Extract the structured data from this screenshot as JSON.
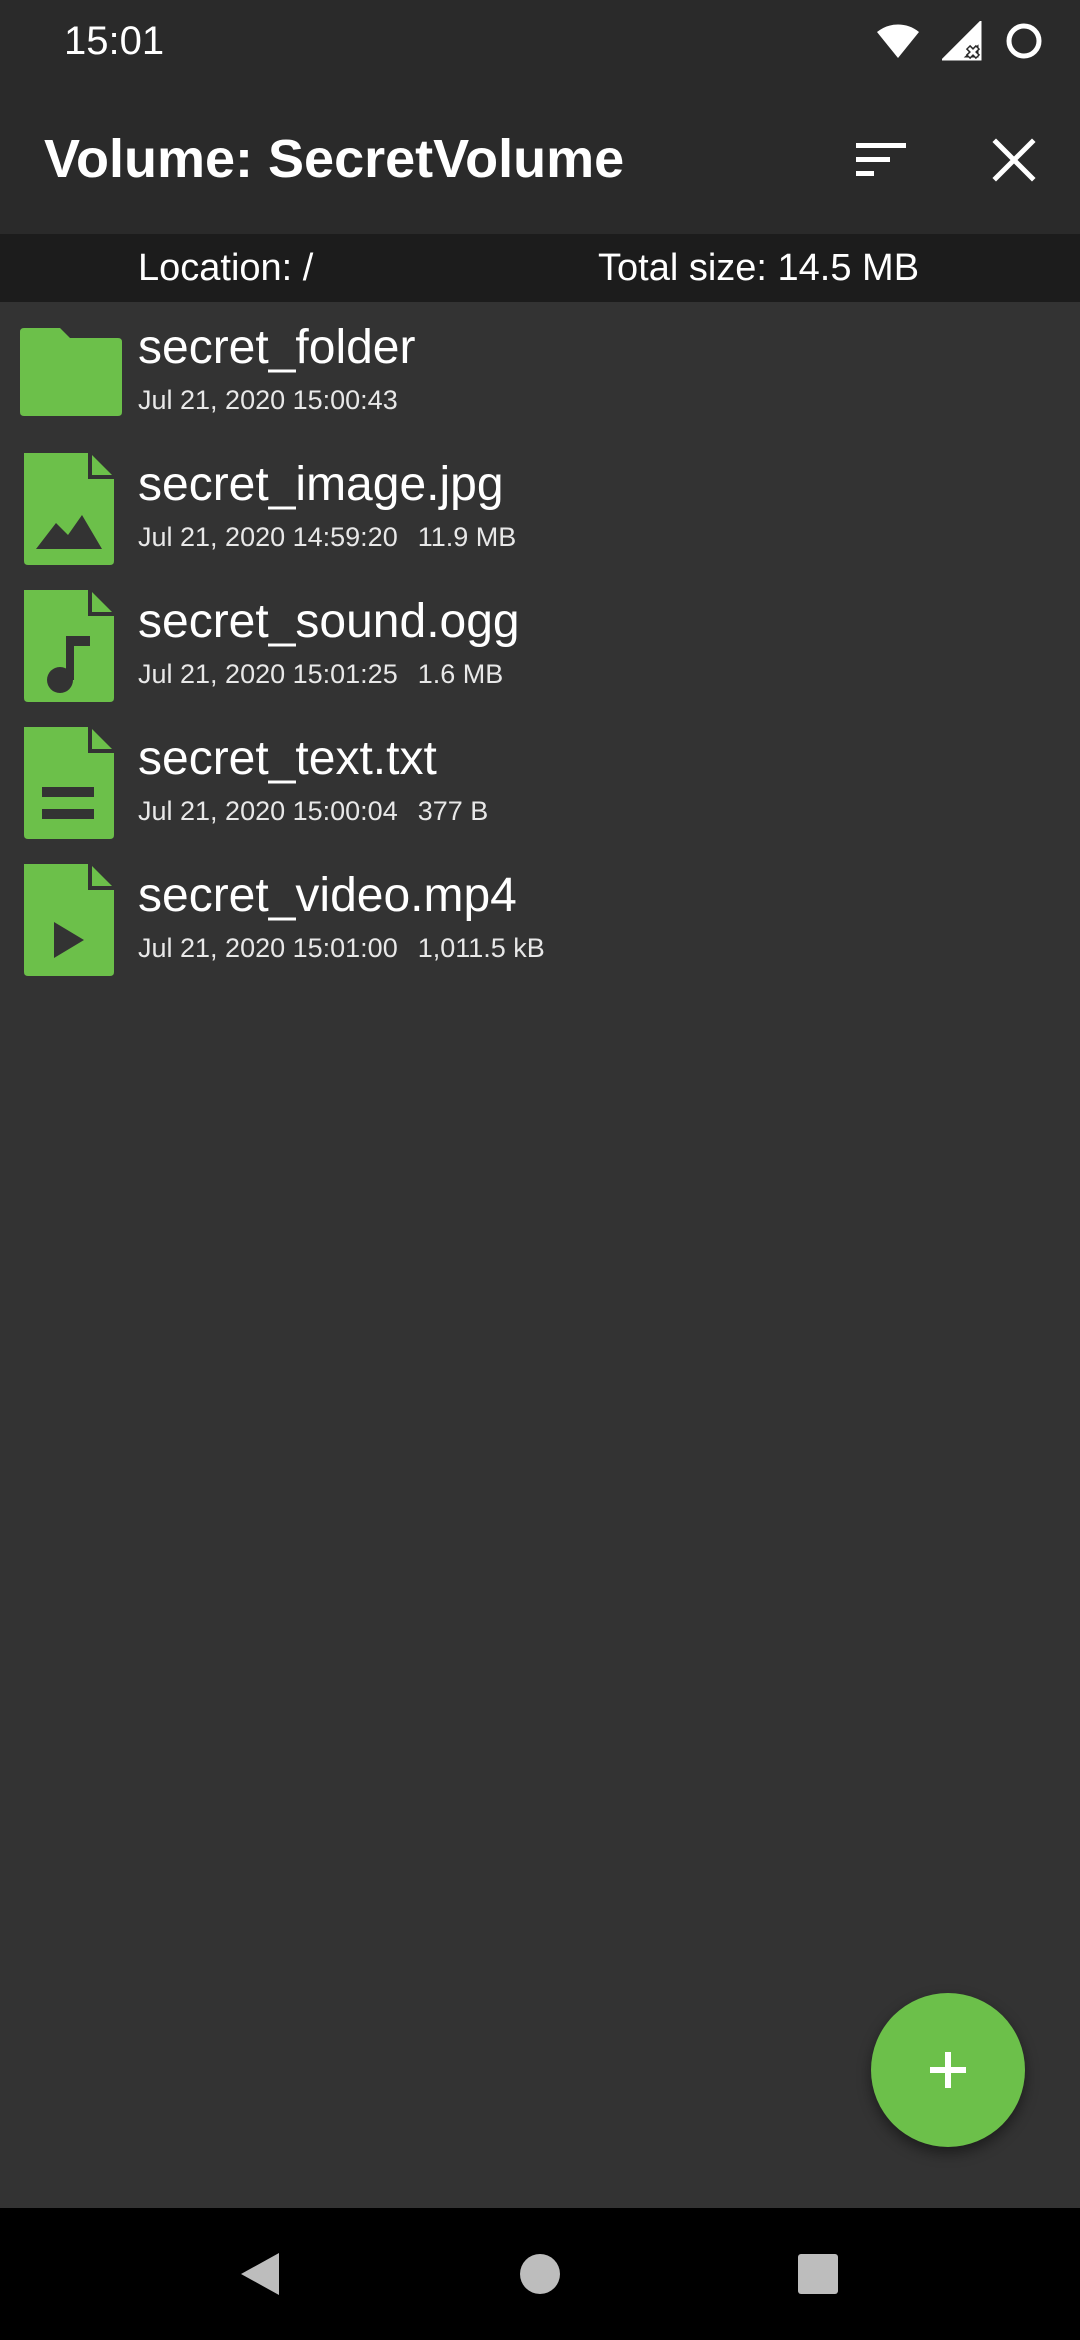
{
  "status_bar": {
    "time": "15:01"
  },
  "app_bar": {
    "title": "Volume: SecretVolume",
    "sort_icon": "sort-icon",
    "close_icon": "close-icon"
  },
  "info_bar": {
    "location": "Location: /",
    "total_size": "Total size: 14.5 MB"
  },
  "files": [
    {
      "name": "secret_folder",
      "date": "Jul 21, 2020 15:00:43",
      "size": "",
      "type": "folder"
    },
    {
      "name": "secret_image.jpg",
      "date": "Jul 21, 2020 14:59:20",
      "size": "11.9 MB",
      "type": "image"
    },
    {
      "name": "secret_sound.ogg",
      "date": "Jul 21, 2020 15:01:25",
      "size": "1.6 MB",
      "type": "audio"
    },
    {
      "name": "secret_text.txt",
      "date": "Jul 21, 2020 15:00:04",
      "size": "377 B",
      "type": "text"
    },
    {
      "name": "secret_video.mp4",
      "date": "Jul 21, 2020 15:01:00",
      "size": "1,011.5 kB",
      "type": "video"
    }
  ],
  "fab": {
    "icon": "plus-icon"
  },
  "nav_bar": {
    "back_icon": "back-icon",
    "home_icon": "home-icon",
    "recents_icon": "recents-icon"
  },
  "colors": {
    "accent": "#6cc04a",
    "app_bar_bg": "#2a2a2a",
    "info_bar_bg": "#1c1c1c",
    "content_bg": "#333333",
    "nav_bar_bg": "#000000"
  }
}
